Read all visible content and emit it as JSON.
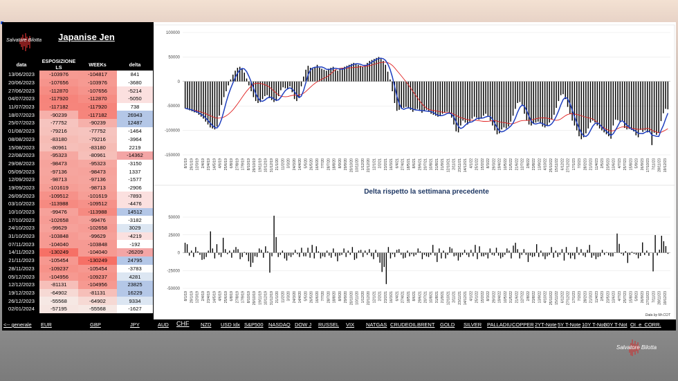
{
  "title": "Japanise Jen",
  "brand": "Salvatore Bilotta",
  "credit": "Data by Mr.COT",
  "table": {
    "headers": [
      "data",
      "ESPOSIZIONE LS",
      "WEEKs",
      "delta"
    ],
    "rows": [
      [
        "13/06/2023",
        "-103976",
        "-104817",
        "841"
      ],
      [
        "20/06/2023",
        "-107656",
        "-103976",
        "-3680"
      ],
      [
        "27/06/2023",
        "-112870",
        "-107656",
        "-5214"
      ],
      [
        "04/07/2023",
        "-117920",
        "-112870",
        "-5050"
      ],
      [
        "11/07/2023",
        "-117182",
        "-117920",
        "738"
      ],
      [
        "18/07/2023",
        "-90239",
        "-117182",
        "26943"
      ],
      [
        "25/07/2023",
        "-77752",
        "-90239",
        "12487"
      ],
      [
        "01/08/2023",
        "-79216",
        "-77752",
        "-1464"
      ],
      [
        "08/08/2023",
        "-83180",
        "-79216",
        "-3964"
      ],
      [
        "15/08/2023",
        "-80961",
        "-83180",
        "2219"
      ],
      [
        "22/08/2023",
        "-95323",
        "-80961",
        "-14362"
      ],
      [
        "29/08/2023",
        "-98473",
        "-95323",
        "-3150"
      ],
      [
        "05/09/2023",
        "-97136",
        "-98473",
        "1337"
      ],
      [
        "12/09/2023",
        "-98713",
        "-97136",
        "-1577"
      ],
      [
        "19/09/2023",
        "-101619",
        "-98713",
        "-2906"
      ],
      [
        "26/09/2023",
        "-109512",
        "-101619",
        "-7893"
      ],
      [
        "03/10/2023",
        "-113988",
        "-109512",
        "-4476"
      ],
      [
        "10/10/2023",
        "-99476",
        "-113988",
        "14512"
      ],
      [
        "17/10/2023",
        "-102658",
        "-99476",
        "-3182"
      ],
      [
        "24/10/2023",
        "-99629",
        "-102658",
        "3029"
      ],
      [
        "31/10/2023",
        "-103848",
        "-99629",
        "-4219"
      ],
      [
        "07/11/2023",
        "-104040",
        "-103848",
        "-192"
      ],
      [
        "14/11/2023",
        "-130249",
        "-104040",
        "-26209"
      ],
      [
        "21/11/2023",
        "-105454",
        "-130249",
        "24795"
      ],
      [
        "28/11/2023",
        "-109237",
        "-105454",
        "-3783"
      ],
      [
        "05/12/2023",
        "-104956",
        "-109237",
        "4281"
      ],
      [
        "12/12/2023",
        "-81131",
        "-104956",
        "23825"
      ],
      [
        "19/12/2023",
        "-64902",
        "-81131",
        "16229"
      ],
      [
        "26/12/2023",
        "-55568",
        "-64902",
        "9334"
      ],
      [
        "02/01/2024",
        "-57195",
        "-55568",
        "-1627"
      ]
    ]
  },
  "nav": [
    "<-- generale",
    "EUR",
    "GBP",
    "JPY",
    "AUD",
    "CHF",
    "NZD",
    "USD Idx",
    "S&P500",
    "NASDAQ",
    "DOW J",
    "RUSSEL",
    "VIX",
    "NATGAS",
    "CRUDEOIL",
    "BRENT",
    "GOLD",
    "SILVER",
    "PALLADIU",
    "COPPER",
    "2YT-Note",
    "5Y T-Note",
    "10Y T-Not",
    "30Y T-Not",
    "OI_e_CORR."
  ],
  "chart_data": [
    {
      "type": "bar",
      "subtype": "bar with line overlays",
      "title": "",
      "ylim": [
        -150000,
        100000
      ],
      "yticks": [
        "100000",
        "50000",
        "0",
        "-50000",
        "-100000",
        "-150000"
      ],
      "xticks": [
        "8/1/19",
        "29/1/19",
        "12/3/19",
        "2/4/19",
        "23/4/19",
        "14/5/19",
        "4/6/19",
        "25/6/19",
        "6/8/19",
        "27/8/19",
        "17/9/19",
        "8/10/19",
        "29/10/19",
        "19/11/19",
        "10/12/19",
        "31/12/19",
        "21/1/20",
        "11/2/20",
        "3/3/20",
        "24/3/20",
        "14/4/20",
        "5/5/20",
        "26/5/20",
        "16/6/20",
        "7/7/20",
        "28/7/20",
        "18/8/20",
        "8/9/20",
        "29/9/20",
        "20/10/20",
        "10/11/20",
        "1/12/20",
        "22/12/20",
        "12/1/21",
        "2/2/21",
        "23/2/21",
        "16/3/21",
        "6/4/21",
        "27/4/21",
        "18/5/21",
        "8/6/21",
        "29/6/21",
        "20/7/21",
        "10/8/21",
        "31/8/21",
        "21/9/21",
        "12/10/21",
        "2/11/21",
        "23/11/21",
        "14/12/21",
        "4/1/22",
        "25/1/22",
        "15/2/22",
        "8/3/22",
        "29/3/22",
        "19/4/22",
        "10/5/22",
        "31/5/22",
        "21/6/22",
        "12/7/22",
        "2/8/22",
        "23/8/22",
        "13/9/22",
        "4/10/22",
        "25/10/22",
        "15/11/22",
        "6/12/22",
        "27/12/22",
        "17/1/23",
        "7/2/23",
        "28/2/23",
        "21/3/23",
        "11/4/23",
        "2/5/23",
        "23/5/23",
        "13/6/23",
        "4/7/23",
        "25/7/23",
        "15/8/23",
        "5/9/23",
        "26/9/23",
        "17/10/23",
        "7/11/23",
        "28/11/23",
        "19/12/23"
      ],
      "series": [
        {
          "role": "net position bars",
          "color": "#000000",
          "values": [
            -55000,
            -57000,
            -59000,
            -61000,
            -63000,
            -64000,
            -68000,
            -72000,
            -76000,
            -82000,
            -88000,
            -94000,
            -96000,
            -98000,
            -92000,
            -70000,
            -48000,
            -32000,
            -20000,
            -8000,
            4000,
            14000,
            22000,
            28000,
            30000,
            26000,
            18000,
            6000,
            -8000,
            -20000,
            -32000,
            -40000,
            -44000,
            -42000,
            -36000,
            -30000,
            -28000,
            -34000,
            -38000,
            -42000,
            -40000,
            -30000,
            -18000,
            -12000,
            -14000,
            -16000,
            -10000,
            -22000,
            -36000,
            -40000,
            -34000,
            -10000,
            10000,
            24000,
            32000,
            28000,
            26000,
            30000,
            34000,
            28000,
            26000,
            24000,
            22000,
            26000,
            28000,
            30000,
            24000,
            22000,
            26000,
            28000,
            30000,
            32000,
            34000,
            36000,
            38000,
            36000,
            34000,
            32000,
            30000,
            34000,
            38000,
            42000,
            44000,
            46000,
            48000,
            50000,
            46000,
            42000,
            34000,
            20000,
            4000,
            -20000,
            -44000,
            -60000,
            -58000,
            -56000,
            -54000,
            -52000,
            -54000,
            -58000,
            -62000,
            -58000,
            -56000,
            -60000,
            -64000,
            -60000,
            -58000,
            -62000,
            -66000,
            -68000,
            -70000,
            -72000,
            -70000,
            -66000,
            -64000,
            -62000,
            -66000,
            -74000,
            -88000,
            -102000,
            -104000,
            -90000,
            -80000,
            -84000,
            -88000,
            -82000,
            -76000,
            -72000,
            -74000,
            -78000,
            -76000,
            -70000,
            -66000,
            -72000,
            -80000,
            -90000,
            -100000,
            -108000,
            -106000,
            -98000,
            -94000,
            -96000,
            -92000,
            -82000,
            -70000,
            -56000,
            -44000,
            -42000,
            -50000,
            -66000,
            -80000,
            -88000,
            -90000,
            -86000,
            -84000,
            -82000,
            -86000,
            -92000,
            -94000,
            -90000,
            -84000,
            -78000,
            -68000,
            -54000,
            -40000,
            -28000,
            -26000,
            -36000,
            -52000,
            -66000,
            -80000,
            -90000,
            -100000,
            -112000,
            -118000,
            -114000,
            -106000,
            -96000,
            -84000,
            -80000,
            -84000,
            -90000,
            -96000,
            -100000,
            -104000,
            -108000,
            -112000,
            -117000,
            -90000,
            -78000,
            -79000,
            -83000,
            -81000,
            -95000,
            -98000,
            -97000,
            -99000,
            -102000,
            -110000,
            -114000,
            -99000,
            -103000,
            -100000,
            -104000,
            -104000,
            -130000,
            -105000,
            -109000,
            -105000,
            -81000,
            -65000,
            -56000,
            -57000
          ]
        },
        {
          "role": "fast moving average",
          "color": "#1f3fbf"
        },
        {
          "role": "slow moving average",
          "color": "#e02020"
        }
      ]
    },
    {
      "type": "bar",
      "title": "Delta rispetto la settimana precedente",
      "ylim": [
        -50000,
        50000
      ],
      "yticks": [
        "50000",
        "25000",
        "0",
        "-25000",
        "-50000"
      ],
      "values": [
        14000,
        12000,
        -4000,
        3000,
        -6000,
        8000,
        2000,
        -3000,
        -10000,
        -9000,
        -6000,
        3000,
        30000,
        6000,
        -8000,
        12000,
        -3000,
        -6000,
        21000,
        5000,
        -2000,
        3000,
        -7000,
        4000,
        8000,
        5000,
        -9000,
        -6000,
        1000,
        -3000,
        -12000,
        -20000,
        -14000,
        -5000,
        -6000,
        6000,
        4000,
        -7000,
        9000,
        2000,
        -28000,
        -5000,
        52000,
        22000,
        -6000,
        -3000,
        3000,
        -8000,
        -11000,
        -4000,
        -6000,
        -3000,
        4000,
        -2000,
        -6000,
        7000,
        -5000,
        -5000,
        7000,
        -7000,
        11000,
        -8000,
        9000,
        2000,
        -8000,
        -5000,
        -6000,
        3000,
        -4000,
        -7000,
        6000,
        -5000,
        -12000,
        -4000,
        -3000,
        6000,
        -6000,
        3000,
        -3000,
        8000,
        -10000,
        -8000,
        3000,
        4000,
        -6000,
        3000,
        -3000,
        5000,
        -5000,
        -9000,
        4000,
        -6000,
        -14000,
        -27000,
        -20000,
        -44000,
        8000,
        -8000,
        -2000,
        -6000,
        4000,
        5000,
        -3000,
        -8000,
        -7000,
        3000,
        -5000,
        -2000,
        -5000,
        -3000,
        6000,
        2000,
        -9000,
        -3000,
        -5000,
        -6000,
        -3000,
        11000,
        -4000,
        -13000,
        6000,
        -8000,
        3000,
        -8000,
        -3000,
        8000,
        6000,
        -5000,
        -4000,
        -11000,
        -6000,
        -3000,
        4000,
        -3000,
        -6000,
        4000,
        -5000,
        11000,
        -9000,
        9000,
        -5000,
        -5000,
        -3000,
        -8000,
        6000,
        -3000,
        -4000,
        7000,
        -4000,
        -8000,
        -6000,
        -3000,
        6000,
        3000,
        -8000,
        10000,
        14000,
        5000,
        -8000,
        -3000,
        5000,
        -3000,
        -13000,
        -4000,
        -6000,
        -5000,
        12000,
        -6000,
        3000,
        -5000,
        -9000,
        -5000,
        -3000,
        8000,
        -7000,
        3000,
        -6000,
        -3000,
        5000,
        -11000,
        8000,
        -3000,
        -8000,
        -4000,
        -9000,
        8000,
        -3000,
        5000,
        -4000,
        -6000,
        4000,
        11000,
        -7000,
        -4000,
        -9000,
        -6000,
        -5000,
        4000,
        -3000,
        841,
        -3680,
        -5214,
        -5050,
        738,
        26943,
        12487,
        -1464,
        -3964,
        2219,
        -14362,
        -3150,
        1337,
        -1577,
        -2906,
        -7893,
        -4476,
        14512,
        -3182,
        3029,
        -4219,
        -192,
        -26209,
        24795,
        -3783,
        4281,
        23825,
        16229,
        9334,
        -1627
      ]
    }
  ]
}
